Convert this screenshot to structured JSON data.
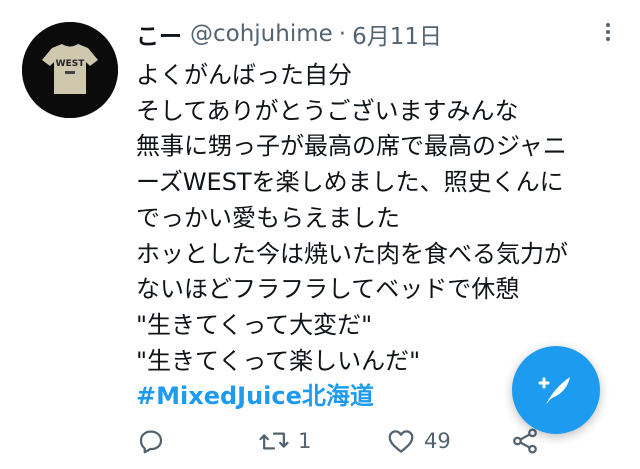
{
  "tweet": {
    "display_name": "こー",
    "handle": "@cohjuhime",
    "separator": "·",
    "date": "6月11日",
    "lines": [
      "よくがんばった自分",
      "そしてありがとうございますみんな",
      "無事に甥っ子が最高の席で最高のジャニ",
      "ーズWESTを楽しめました、照史くんに",
      "でっかい愛もらえました",
      "ホッとした今は焼いた肉を食べる気力が",
      "ないほどフラフラしてベッドで休憩",
      "\"生きてくって大変だ\"",
      "\"生きてくって楽しいんだ\""
    ],
    "hashtag": "#MixedJuice北海道",
    "retweet_count": "1",
    "like_count": "49"
  },
  "icons": {
    "avatar": "avatar-tshirt-west",
    "more": "more-vertical-icon",
    "reply": "reply-icon",
    "retweet": "retweet-icon",
    "like": "heart-icon",
    "share": "share-icon",
    "compose": "compose-tweet-icon"
  },
  "avatar_shirt_text": "WEST",
  "colors": {
    "accent": "#1d9bf0",
    "text": "#0f1419",
    "secondary": "#536471"
  }
}
